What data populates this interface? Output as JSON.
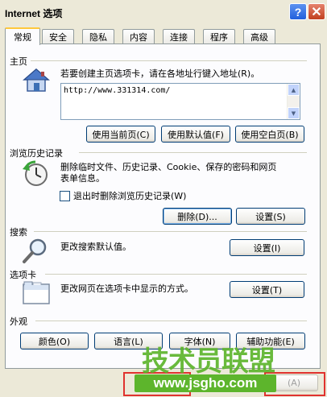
{
  "window": {
    "title": "Internet 选项",
    "help_glyph": "?",
    "close_glyph": "✕"
  },
  "tabs": [
    {
      "label": "常规",
      "active": true
    },
    {
      "label": "安全"
    },
    {
      "label": "隐私"
    },
    {
      "label": "内容"
    },
    {
      "label": "连接"
    },
    {
      "label": "程序"
    },
    {
      "label": "高级"
    }
  ],
  "home": {
    "title": "主页",
    "icon": "house-icon",
    "description": "若要创建主页选项卡，请在各地址行键入地址(R)。",
    "url": "http://www.331314.com/",
    "btn_current": "使用当前页(C)",
    "btn_default": "使用默认值(F)",
    "btn_blank": "使用空白页(B)"
  },
  "history": {
    "title": "浏览历史记录",
    "icon": "clock-history-icon",
    "description_line1": "删除临时文件、历史记录、Cookie、保存的密码和网页",
    "description_line2": "表单信息。",
    "checkbox_label": "退出时删除浏览历史记录(W)",
    "checkbox_checked": false,
    "btn_delete": "删除(D)...",
    "btn_settings": "设置(S)"
  },
  "search": {
    "title": "搜索",
    "icon": "magnifier-icon",
    "description": "更改搜索默认值。",
    "btn_settings": "设置(I)"
  },
  "tabs_group": {
    "title": "选项卡",
    "icon": "tab-window-icon",
    "description": "更改网页在选项卡中显示的方式。",
    "btn_settings": "设置(T)"
  },
  "appearance": {
    "title": "外观",
    "btn_colors": "颜色(O)",
    "btn_languages": "语言(L)",
    "btn_fonts": "字体(N)",
    "btn_accessibility": "辅助功能(E)"
  },
  "footer": {
    "apply_label": "(A)"
  },
  "watermark": {
    "brand": "技术员联盟",
    "url": "www.jsgho.com"
  },
  "colors": {
    "accent_green": "#5db52c",
    "highlight_red": "#e0322e",
    "tab_active_top": "#ffc83c"
  }
}
